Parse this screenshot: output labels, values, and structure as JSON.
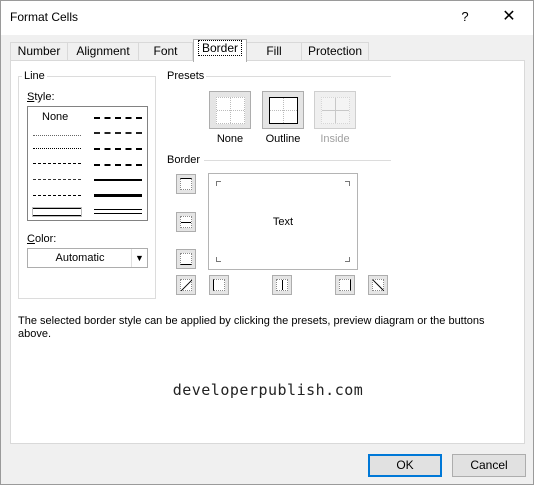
{
  "window": {
    "title": "Format Cells",
    "help_label": "?",
    "close_label": "✕"
  },
  "tabs": [
    {
      "label": "Number"
    },
    {
      "label": "Alignment"
    },
    {
      "label": "Font"
    },
    {
      "label": "Border"
    },
    {
      "label": "Fill"
    },
    {
      "label": "Protection"
    }
  ],
  "active_tab": "Border",
  "line_group": {
    "label": "Line",
    "style_label": "Style:",
    "style_none_label": "None",
    "color_label": "Color:",
    "color_value": "Automatic"
  },
  "presets": {
    "label": "Presets",
    "none_label": "None",
    "outline_label": "Outline",
    "inside_label": "Inside"
  },
  "border": {
    "label": "Border",
    "preview_text": "Text"
  },
  "description": "The selected border style can be applied by clicking the presets, preview diagram or the buttons above.",
  "watermark": "developerpublish.com",
  "buttons": {
    "ok_label": "OK",
    "cancel_label": "Cancel"
  }
}
